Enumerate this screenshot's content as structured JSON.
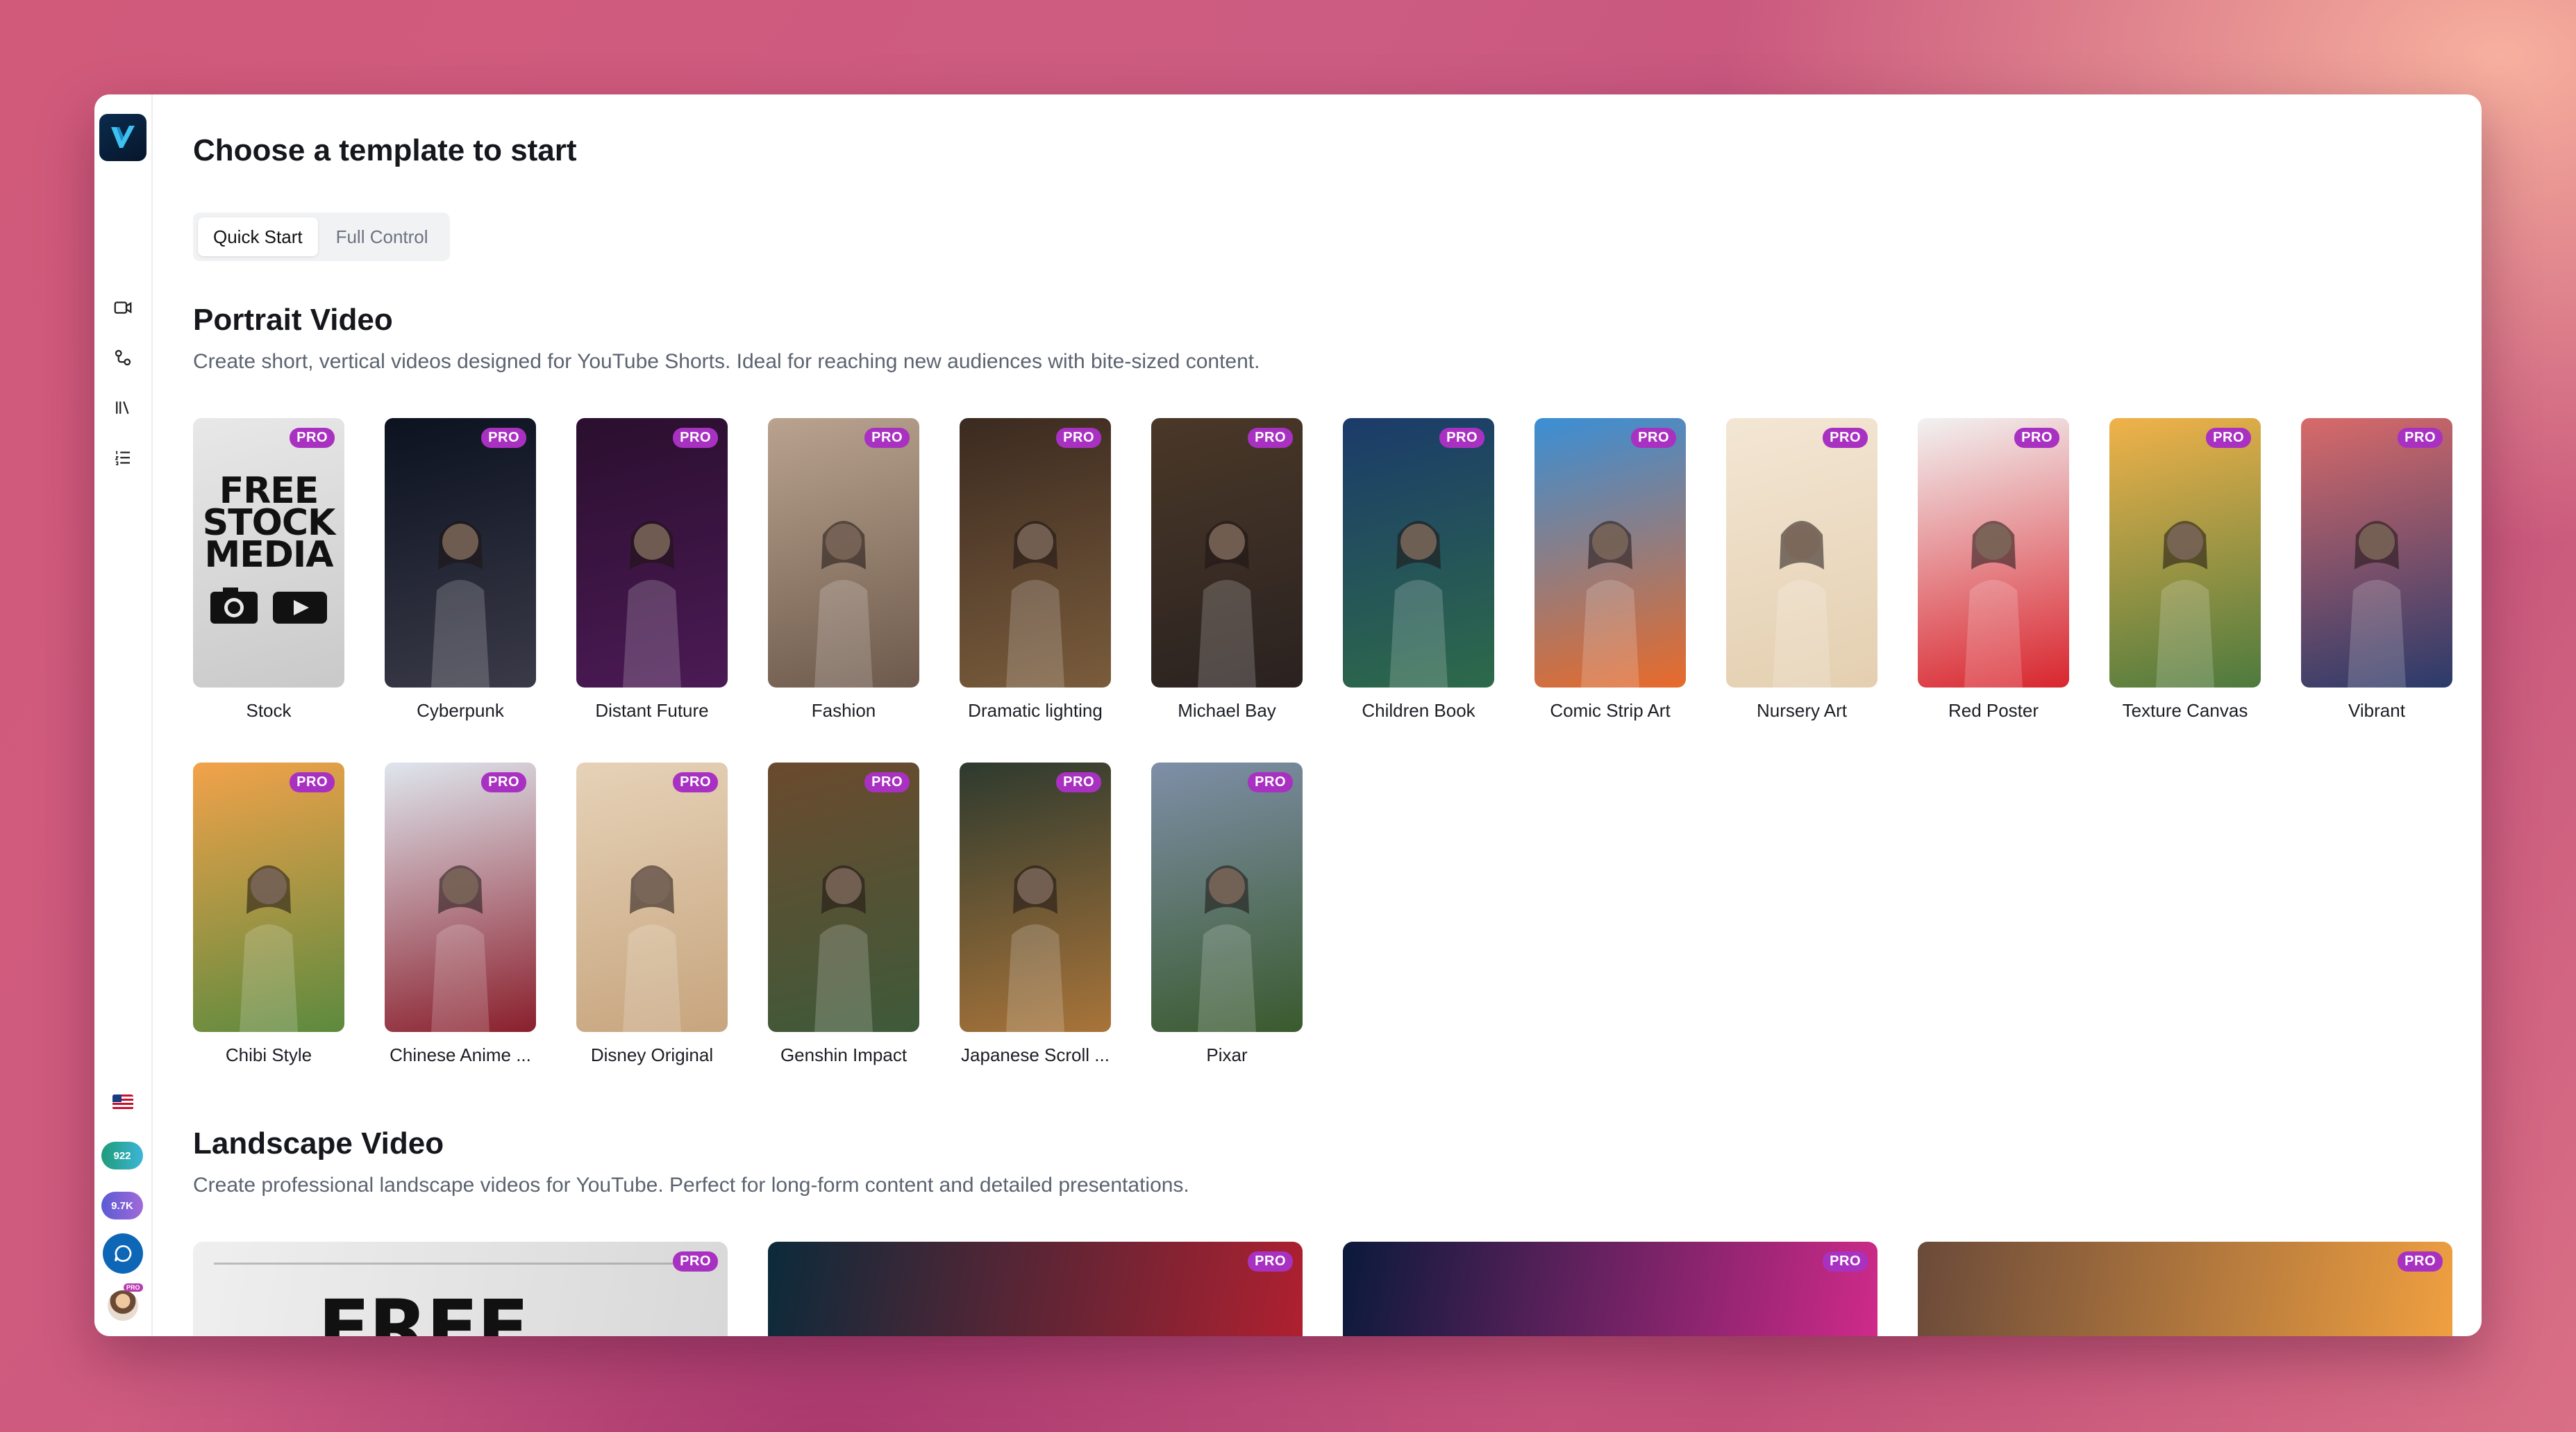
{
  "header": {
    "title": "Choose a template to start"
  },
  "tabs": [
    {
      "label": "Quick Start",
      "active": true
    },
    {
      "label": "Full Control",
      "active": false
    }
  ],
  "sidebar": {
    "icons": [
      "video-icon",
      "workflow-icon",
      "library-icon",
      "list-icon"
    ],
    "credits_primary": "922",
    "credits_secondary": "9.7K",
    "avatar_badge": "PRO"
  },
  "badge_label": "PRO",
  "portrait": {
    "title": "Portrait Video",
    "description": "Create short, vertical videos designed for YouTube Shorts. Ideal for reaching new audiences with bite-sized content.",
    "stock_text": [
      "FREE",
      "STOCK",
      "MEDIA"
    ],
    "templates": [
      {
        "name": "Stock",
        "pro": true,
        "colors": [
          "#e8e8e8",
          "#c9c9c9"
        ]
      },
      {
        "name": "Cyberpunk",
        "pro": true,
        "colors": [
          "#0c1220",
          "#3a3a48"
        ]
      },
      {
        "name": "Distant Future",
        "pro": true,
        "colors": [
          "#2a0f2e",
          "#4b1a55"
        ]
      },
      {
        "name": "Fashion",
        "pro": true,
        "colors": [
          "#b9a38f",
          "#6e5a4c"
        ]
      },
      {
        "name": "Dramatic lighting",
        "pro": true,
        "colors": [
          "#3b2a20",
          "#7a5c3c"
        ]
      },
      {
        "name": "Michael Bay",
        "pro": true,
        "colors": [
          "#4a3828",
          "#2a2220"
        ]
      },
      {
        "name": "Children Book",
        "pro": true,
        "colors": [
          "#1b3b6a",
          "#2d6a4a"
        ]
      },
      {
        "name": "Comic Strip Art",
        "pro": true,
        "colors": [
          "#3a8fd6",
          "#e86a2a"
        ]
      },
      {
        "name": "Nursery Art",
        "pro": true,
        "colors": [
          "#f3e6d4",
          "#e4cfb0"
        ]
      },
      {
        "name": "Red Poster",
        "pro": true,
        "colors": [
          "#f2f2f2",
          "#d9262e"
        ]
      },
      {
        "name": "Texture Canvas",
        "pro": true,
        "colors": [
          "#f1b24a",
          "#4d7a3e"
        ]
      },
      {
        "name": "Vibrant",
        "pro": true,
        "colors": [
          "#d86a6a",
          "#2b3a6a"
        ]
      },
      {
        "name": "Chibi Style",
        "pro": true,
        "colors": [
          "#f2a24a",
          "#5c8a3e"
        ]
      },
      {
        "name": "Chinese Anime ...",
        "pro": true,
        "colors": [
          "#dfe6ee",
          "#8a1f2c"
        ]
      },
      {
        "name": "Disney Original",
        "pro": true,
        "colors": [
          "#e6d2b8",
          "#c7a57e"
        ]
      },
      {
        "name": "Genshin Impact",
        "pro": true,
        "colors": [
          "#6b4a2e",
          "#3e5a3a"
        ]
      },
      {
        "name": "Japanese Scroll ...",
        "pro": true,
        "colors": [
          "#2e3a2e",
          "#a8743a"
        ]
      },
      {
        "name": "Pixar",
        "pro": true,
        "colors": [
          "#7e8fa8",
          "#3a5a2e"
        ]
      }
    ]
  },
  "landscape": {
    "title": "Landscape Video",
    "description": "Create professional landscape videos for YouTube. Perfect for long-form content and detailed presentations.",
    "stock_text": "FREE",
    "cards": [
      {
        "name": "stock-landscape",
        "colors": [
          "#efefef",
          "#d8d8d8"
        ]
      },
      {
        "name": "cyberpunk-landscape",
        "colors": [
          "#0b2a3a",
          "#b02030"
        ]
      },
      {
        "name": "city-night-landscape",
        "colors": [
          "#0a1a3a",
          "#d02a8a"
        ]
      },
      {
        "name": "sunset-landscape",
        "colors": [
          "#6a4a3a",
          "#f0a040"
        ]
      }
    ]
  }
}
